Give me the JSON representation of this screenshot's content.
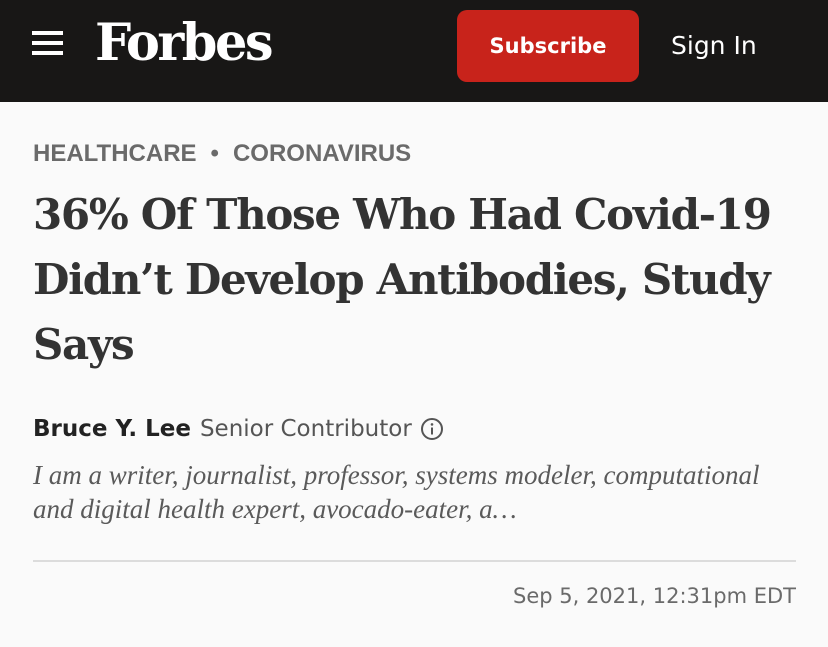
{
  "header": {
    "menu_icon": "hamburger-menu-icon",
    "logo_text": "Forbes",
    "subscribe_label": "Subscribe",
    "signin_label": "Sign In",
    "bar_color": "#181716",
    "subscribe_color": "#c8231b"
  },
  "article": {
    "breadcrumb": {
      "section": "HEALTHCARE",
      "separator": "•",
      "topic": "CORONAVIRUS"
    },
    "headline": "36% Of Those Who Had Covid-19 Didn’t Develop Antibodies, Study Says",
    "author": {
      "name": "Bruce Y. Lee",
      "role": "Senior Contributor",
      "info_icon": "info-circle-icon"
    },
    "bio": "I am a writer, journalist, professor, systems modeler, computational and digital health expert, avocado-eater, a…",
    "timestamp": "Sep 5, 2021, 12:31pm EDT"
  }
}
